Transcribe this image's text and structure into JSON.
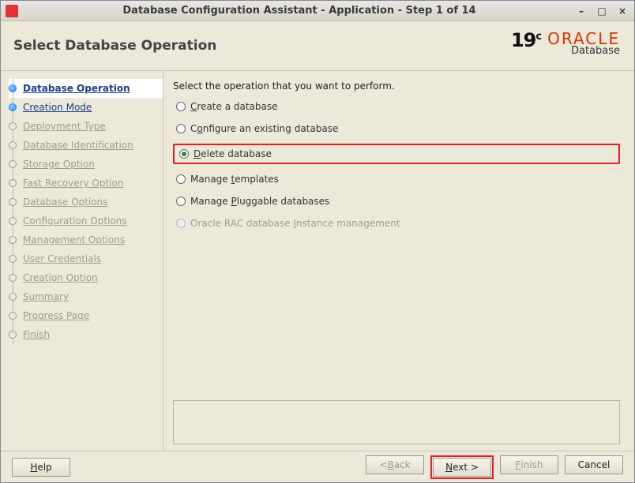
{
  "window": {
    "title": "Database Configuration Assistant - Application - Step 1 of 14"
  },
  "header": {
    "title": "Select Database Operation",
    "version": "19",
    "version_suffix": "c",
    "brand": "ORACLE",
    "product": "Database"
  },
  "sidebar": {
    "steps": [
      {
        "label": "Database Operation",
        "state": "active"
      },
      {
        "label": "Creation Mode",
        "state": "done"
      },
      {
        "label": "Deployment Type",
        "state": "disabled"
      },
      {
        "label": "Database Identification",
        "state": "disabled"
      },
      {
        "label": "Storage Option",
        "state": "disabled"
      },
      {
        "label": "Fast Recovery Option",
        "state": "disabled"
      },
      {
        "label": "Database Options",
        "state": "disabled"
      },
      {
        "label": "Configuration Options",
        "state": "disabled"
      },
      {
        "label": "Management Options",
        "state": "disabled"
      },
      {
        "label": "User Credentials",
        "state": "disabled"
      },
      {
        "label": "Creation Option",
        "state": "disabled"
      },
      {
        "label": "Summary",
        "state": "disabled"
      },
      {
        "label": "Progress Page",
        "state": "disabled"
      },
      {
        "label": "Finish",
        "state": "disabled"
      }
    ]
  },
  "content": {
    "prompt": "Select the operation that you want to perform.",
    "options": [
      {
        "pre": "",
        "mn": "C",
        "post": "reate a database",
        "selected": false,
        "enabled": true,
        "highlight": false
      },
      {
        "pre": "C",
        "mn": "o",
        "post": "nfigure an existing database",
        "selected": false,
        "enabled": true,
        "highlight": false
      },
      {
        "pre": "",
        "mn": "D",
        "post": "elete database",
        "selected": true,
        "enabled": true,
        "highlight": true
      },
      {
        "pre": "Manage ",
        "mn": "t",
        "post": "emplates",
        "selected": false,
        "enabled": true,
        "highlight": false
      },
      {
        "pre": "Manage ",
        "mn": "P",
        "post": "luggable databases",
        "selected": false,
        "enabled": true,
        "highlight": false
      },
      {
        "pre": "Oracle RAC database ",
        "mn": "I",
        "post": "nstance management",
        "selected": false,
        "enabled": false,
        "highlight": false
      }
    ]
  },
  "footer": {
    "help": "Help",
    "back": "Back",
    "next": "Next",
    "finish": "Finish",
    "cancel": "Cancel",
    "back_enabled": false,
    "next_enabled": true,
    "finish_enabled": false
  }
}
